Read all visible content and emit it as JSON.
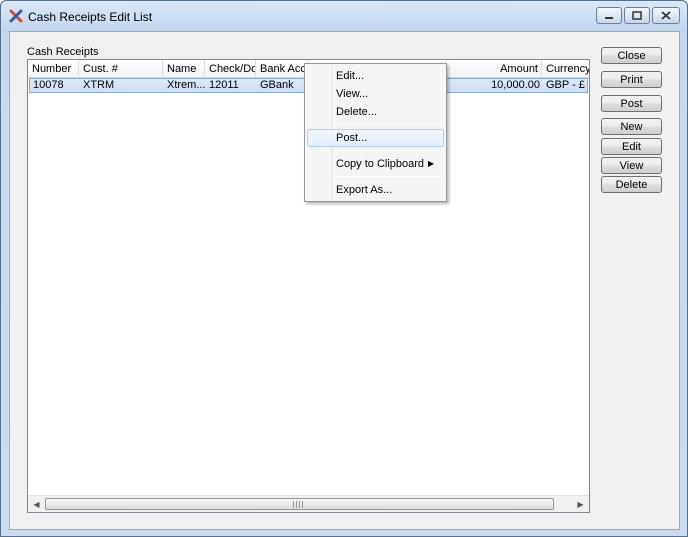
{
  "window": {
    "title": "Cash Receipts Edit List",
    "app_icon": "x-logo-icon",
    "controls": [
      "minimize-icon",
      "maximize-icon",
      "close-icon"
    ]
  },
  "group": {
    "label": "Cash Receipts"
  },
  "grid": {
    "columns": [
      "Number",
      "Cust. #",
      "Name",
      "Check/Do",
      "Bank Acco",
      "Amount",
      "Currency"
    ],
    "rows": [
      {
        "number": "10078",
        "cust": "XTRM",
        "name": "Xtrem...",
        "check": "12011",
        "bank": "GBank",
        "amount": "10,000.00",
        "currency": "GBP - £"
      }
    ]
  },
  "buttons": {
    "close": "Close",
    "print": "Print",
    "post": "Post",
    "new": "New",
    "edit": "Edit",
    "view": "View",
    "delete": "Delete"
  },
  "context_menu": {
    "items": {
      "edit": "Edit...",
      "view": "View...",
      "delete": "Delete...",
      "post": "Post...",
      "copy": "Copy to Clipboard",
      "export": "Export As..."
    },
    "highlighted": "Post..."
  },
  "colors": {
    "title_bar": "#c2d6ee",
    "selection": "#cfdef3",
    "menu_highlight": "#e3eefd"
  }
}
